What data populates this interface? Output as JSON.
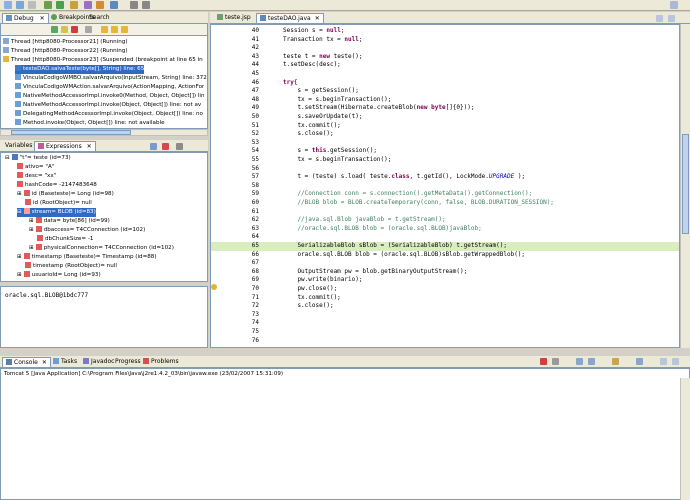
{
  "debug_view": {
    "tabs": [
      {
        "label": "Debug"
      },
      {
        "label": "Breakpoints"
      },
      {
        "label": "Search"
      }
    ],
    "threads": [
      "Thread [http8080-Processor21] (Running)",
      "Thread [http8080-Processor22] (Running)",
      "Thread [http8080-Processor23] (Suspended (breakpoint at line 65 in",
      "testeDAO.salvaTeste(byte[], String) line: 65",
      "VinculaCodigoWMBO.salvarArquivo(InputStream, String) line: 372",
      "VinculaCodigoWMAction.salvarArquivo(ActionMapping, ActionFor",
      "NativeMethodAccessorImpl.invoke0(Method, Object, Object[]) lin",
      "NativeMethodAccessorImpl.invoke(Object, Object[]) line: not av",
      "DelegatingMethodAccessorImpl.invoke(Object, Object[]) line: no",
      "Method.invoke(Object, Object[]) line: not available"
    ]
  },
  "variables_view": {
    "tabs": [
      {
        "label": "Variables"
      },
      {
        "label": "Expressions"
      }
    ],
    "tree": [
      {
        "text": "\"t\"= teste  (id=73)"
      },
      {
        "text": "ativo= \"A\""
      },
      {
        "text": "desc= \"xx\""
      },
      {
        "text": "hashCode= -2147483648"
      },
      {
        "text": "id (Baseteste)= Long  (id=98)"
      },
      {
        "text": "id (RootObject)= null"
      },
      {
        "text": "stream= BLOB  (id=83)"
      },
      {
        "text": "data= byte[86]  (id=99)"
      },
      {
        "text": "dbaccess= T4CConnection  (id=102)"
      },
      {
        "text": "dbChunkSize= -1"
      },
      {
        "text": "physicalConnection= T4CConnection  (id=102)"
      },
      {
        "text": "timestamp (Baseteste)= Timestamp  (id=88)"
      },
      {
        "text": "timestamp (RootObject)= null"
      },
      {
        "text": "usuarioId= Long  (id=93)"
      }
    ],
    "detail": "oracle.sql.BLOB@1bdc777"
  },
  "editor": {
    "tabs": [
      {
        "label": "teste.jsp"
      },
      {
        "label": "testeDAO.java"
      }
    ],
    "lines": [
      {
        "n": "40",
        "code": "Session s = null;"
      },
      {
        "n": "41",
        "code": "Transaction tx = null;"
      },
      {
        "n": "42",
        "code": ""
      },
      {
        "n": "43",
        "code": "teste t = new teste();"
      },
      {
        "n": "44",
        "code": "t.setDesc(desc);"
      },
      {
        "n": "45",
        "code": ""
      },
      {
        "n": "46",
        "code": "try{"
      },
      {
        "n": "47",
        "code": "    s = getSession();"
      },
      {
        "n": "48",
        "code": "    tx = s.beginTransaction();"
      },
      {
        "n": "49",
        "code": "    t.setStream(Hibernate.createBlob(new byte[]{0}));"
      },
      {
        "n": "50",
        "code": "    s.saveOrUpdate(t);"
      },
      {
        "n": "51",
        "code": "    tx.commit();"
      },
      {
        "n": "52",
        "code": "    s.close();"
      },
      {
        "n": "53",
        "code": ""
      },
      {
        "n": "54",
        "code": "    s = this.getSession();"
      },
      {
        "n": "55",
        "code": "    tx = s.beginTransaction();"
      },
      {
        "n": "56",
        "code": ""
      },
      {
        "n": "57",
        "code": "    t = (teste) s.load( teste.class, t.getId(), LockMode.UPGRADE );"
      },
      {
        "n": "58",
        "code": ""
      },
      {
        "n": "59",
        "code": "    //Connection conn = s.connection().getMetaData().getConnection();"
      },
      {
        "n": "60",
        "code": "    //BLOB blob = BLOB.createTemporary(conn, false, BLOB.DURATION_SESSION);"
      },
      {
        "n": "61",
        "code": ""
      },
      {
        "n": "62",
        "code": "    //java.sql.Blob javaBlob = t.getStream();"
      },
      {
        "n": "63",
        "code": "    //oracle.sql.BLOB blob = (oracle.sql.BLOB)javaBlob;"
      },
      {
        "n": "64",
        "code": ""
      },
      {
        "n": "65",
        "code": "    SerializableBlob sBlob = (SerializableBlob) t.getStream();"
      },
      {
        "n": "66",
        "code": "    oracle.sql.BLOB blob = (oracle.sql.BLOB)sBlob.getWrappedBlob();"
      },
      {
        "n": "67",
        "code": ""
      },
      {
        "n": "68",
        "code": "    OutputStream pw = blob.getBinaryOutputStream();"
      },
      {
        "n": "69",
        "code": "    pw.write(binario);"
      },
      {
        "n": "70",
        "code": "    pw.close();"
      },
      {
        "n": "71",
        "code": "    tx.commit();"
      },
      {
        "n": "72",
        "code": "    s.close();"
      },
      {
        "n": "73",
        "code": ""
      },
      {
        "n": "74",
        "code": ""
      },
      {
        "n": "75",
        "code": ""
      },
      {
        "n": "76",
        "code": ""
      }
    ]
  },
  "console_view": {
    "tabs": [
      {
        "label": "Console"
      },
      {
        "label": "Tasks"
      },
      {
        "label": "Javadoc"
      },
      {
        "label": "Progress"
      },
      {
        "label": "Problems"
      }
    ],
    "process_label": "Tomcat 5 [Java Application] C:\\Program Files\\Java\\j2re1.4.2_03\\bin\\javaw.exe (23/02/2007 15:31:09)"
  },
  "colors": {
    "accent": "#316ac5",
    "keyword": "#7f0055",
    "comment": "#3f7f5f",
    "highlight_line": "#d9edbf"
  }
}
